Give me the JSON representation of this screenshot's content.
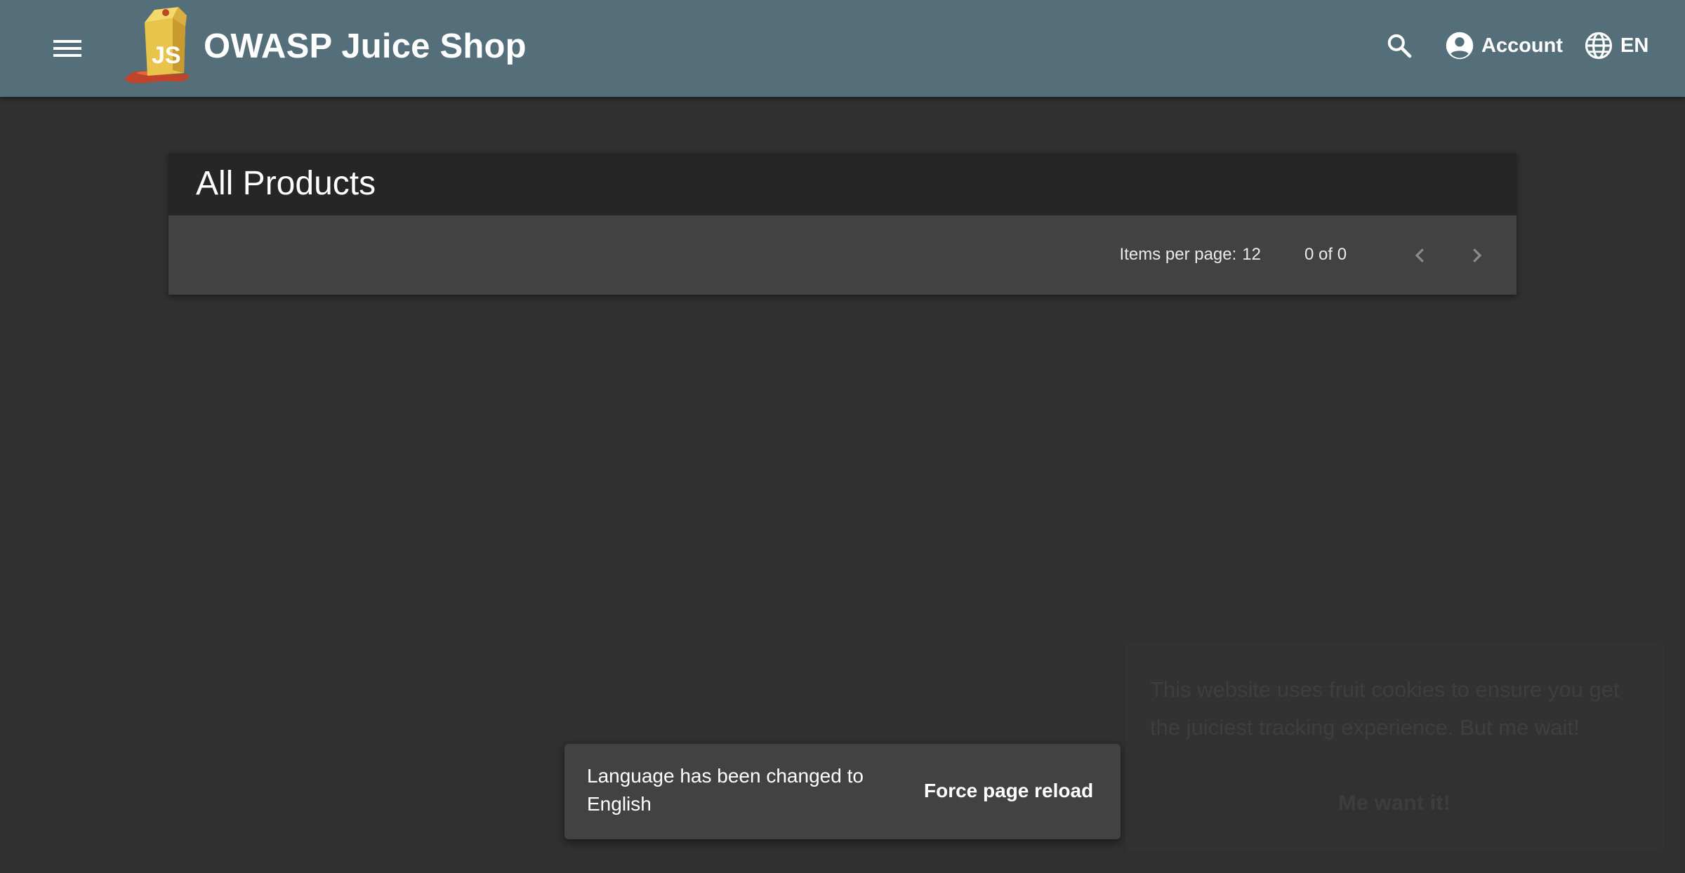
{
  "header": {
    "menu_icon": "menu-icon",
    "logo": "juice-shop-logo",
    "title": "OWASP Juice Shop",
    "search_icon": "search-icon",
    "account_icon": "account-circle-icon",
    "account_label": "Account",
    "language_icon": "globe-icon",
    "language_label": "EN",
    "background_color": "#546e7a"
  },
  "main": {
    "title": "All Products",
    "paginator": {
      "items_per_page_label": "Items per page:",
      "items_per_page_value": "12",
      "range_label": "0 of 0",
      "prev_icon": "chevron-left-icon",
      "next_icon": "chevron-right-icon"
    }
  },
  "cookie_banner": {
    "message": "This website uses fruit cookies to ensure you get the juiciest tracking experience.",
    "link_label": "But me wait!",
    "dismiss_label": "Me want it!"
  },
  "snackbar": {
    "message": "Language has been changed to English",
    "action_label": "Force page reload"
  },
  "colors": {
    "background": "#303030",
    "card_header": "#262626",
    "paginator": "#424242",
    "snackbar": "#424242"
  }
}
